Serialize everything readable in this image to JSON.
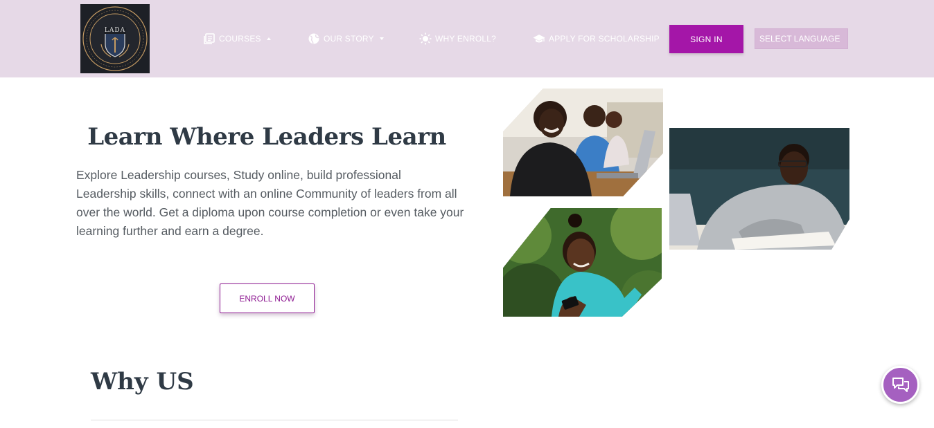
{
  "brand": {
    "logo_text": "LADA",
    "logo_ring_text": "LEADERSHIP AND DEVELOPMENT ACADEMY"
  },
  "nav": {
    "items": [
      {
        "label": "COURSES",
        "icon": "library-books-icon",
        "caret": "up"
      },
      {
        "label": "OUR STORY",
        "icon": "globe-icon",
        "caret": "down"
      },
      {
        "label": "WHY ENROLL?",
        "icon": "sun-icon",
        "caret": ""
      },
      {
        "label": "APPLY FOR SCHOLARSHIP",
        "icon": "graduation-cap-icon",
        "caret": ""
      }
    ],
    "signin_label": "SIGN IN",
    "language_label": "SELECT LANGUAGE"
  },
  "hero": {
    "title": "Learn Where Leaders Learn",
    "description": "Explore Leadership courses, Study online, build professional Leadership skills, connect with an online Community of leaders from all over the world. Get a diploma upon course completion or even take your learning further and earn a degree.",
    "enroll_label": "ENROLL NOW"
  },
  "why": {
    "title": "Why US"
  },
  "colors": {
    "navbar_bg": "#e6d9e7",
    "accent": "#a416a8",
    "enroll_border": "#8e1a92",
    "chat_bg": "#a560c0"
  },
  "icons": {
    "chat": "chat-bubbles-icon"
  }
}
